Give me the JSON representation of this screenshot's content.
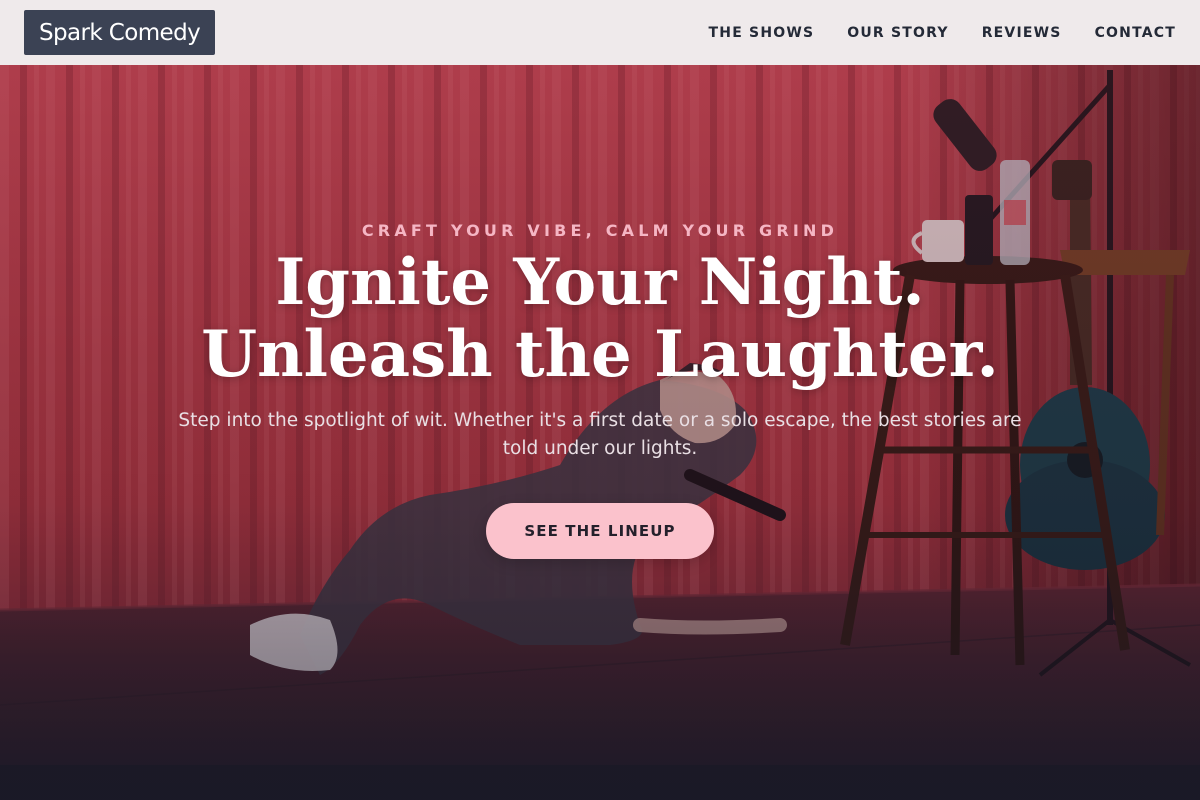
{
  "header": {
    "logo": "Spark Comedy",
    "nav": [
      "THE SHOWS",
      "OUR STORY",
      "REVIEWS",
      "CONTACT"
    ]
  },
  "hero": {
    "tagline": "CRAFT YOUR VIBE, CALM YOUR GRIND",
    "headline_line1": "Ignite Your Night.",
    "headline_line2": "Unleash the Laughter.",
    "subtext": "Step into the spotlight of wit. Whether it's a first date or a solo escape, the best stories are told under our lights.",
    "cta_label": "SEE THE LINEUP"
  },
  "colors": {
    "header_bg": "#efeaeb",
    "logo_bg": "#3b4254",
    "nav_text": "#242a37",
    "tagline": "#f5b6c4",
    "cta_bg": "#fbc2cc",
    "curtain": "#a8323f"
  }
}
